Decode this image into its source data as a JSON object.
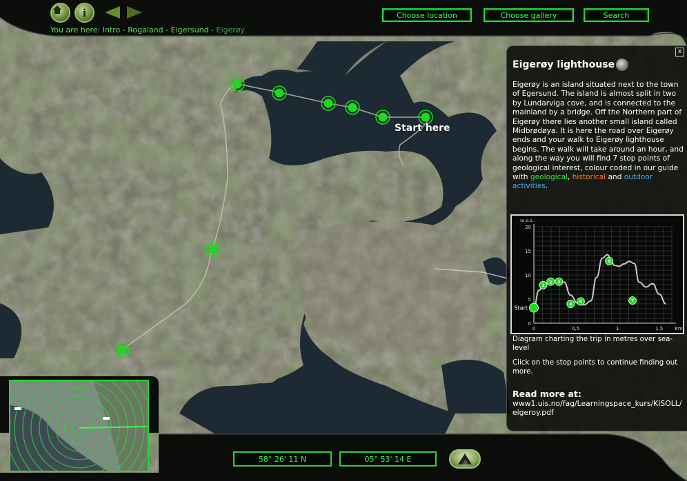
{
  "nav": {
    "home_icon": "home-icon",
    "info_icon": "info-icon",
    "info_label": "i",
    "back_icon": "triangle-left-icon",
    "forward_icon": "triangle-right-icon"
  },
  "breadcrumb": {
    "prefix": "You are here:",
    "items": [
      "Intro",
      "Rogaland",
      "Eigersund"
    ],
    "separator": "-",
    "current": "Eigerøy"
  },
  "toolbar": {
    "choose_location": "Choose location",
    "choose_gallery": "Choose gallery",
    "search": "Search"
  },
  "map": {
    "start_label": "Start here",
    "stop_color": "#1bdc1b"
  },
  "panel": {
    "close_label": "x",
    "title": "Eigerøy lighthouse",
    "sound_icon": "speaker-icon",
    "text_main": "Eigerøy is an island situated next to the town of Egersund. The island is almost split in two by Lundarviga cove, and is connected to the mainland by a bridge. Off the Northern part of Eigerøy there lies another small island called Midbrødøya. It is here the road over Eigerøy ends and your walk to Eigerøy lighthouse begins. The walk will take around an hour, and along the way you will find 7 stop points of geological interest, colour coded in our guide with",
    "geo_word": "geological",
    "comma": ",",
    "his_word": "historical",
    "and_word": "and",
    "out_word": "outdoor activities",
    "period": ".",
    "colors": {
      "geological": "#3ae43a",
      "historical": "#ff7a2a",
      "outdoor": "#3ab0ff"
    },
    "chart_caption": "Diagram charting the trip in metres over sea-level",
    "click_note": "Click on the stop points to continue finding out more.",
    "read_more_title": "Read more at:",
    "read_more_link": "www1.uis.no/fag/Learningspace_kurs/KISOLL/eigeroy.pdf"
  },
  "chart_data": {
    "type": "line",
    "ylabel": "m.o.s.",
    "xlabel": "Km",
    "xlim": [
      0,
      1.65
    ],
    "ylim": [
      0,
      20
    ],
    "x_ticks": [
      0,
      0.5,
      1,
      1.5
    ],
    "x_tick_labels": [
      "0",
      "0,5",
      "1",
      "1,5"
    ],
    "y_ticks": [
      0,
      5,
      10,
      15,
      20
    ],
    "grid": true,
    "start_label": "Start",
    "profile_x": [
      0,
      0.06,
      0.12,
      0.2,
      0.28,
      0.36,
      0.44,
      0.52,
      0.6,
      0.68,
      0.75,
      0.82,
      0.88,
      0.92,
      0.96,
      1.02,
      1.08,
      1.14,
      1.2,
      1.26,
      1.34,
      1.42,
      1.5,
      1.58
    ],
    "profile_y": [
      3.2,
      6.8,
      8.0,
      8.6,
      8.9,
      8.5,
      5.8,
      4.2,
      3.8,
      4.6,
      9.5,
      13.5,
      14.2,
      13.4,
      12.0,
      11.8,
      12.3,
      12.8,
      12.4,
      8.5,
      7.5,
      8.2,
      6.0,
      4.0
    ],
    "stops": [
      {
        "label": "Start",
        "x": 0.0,
        "y": 3.2
      },
      {
        "label": "1",
        "x": 0.11,
        "y": 7.9
      },
      {
        "label": "2",
        "x": 0.2,
        "y": 8.6
      },
      {
        "label": "3",
        "x": 0.3,
        "y": 8.6
      },
      {
        "label": "4",
        "x": 0.44,
        "y": 4.0
      },
      {
        "label": "5",
        "x": 0.56,
        "y": 4.5
      },
      {
        "label": "6",
        "x": 0.9,
        "y": 12.9
      },
      {
        "label": "7",
        "x": 1.18,
        "y": 4.7
      }
    ]
  },
  "coords": {
    "lat": "58° 26' 11 N",
    "lon": "05° 53' 14 E",
    "mountain_icon": "mountain-icon"
  },
  "minimap": {
    "icon": "minimap-radar"
  }
}
